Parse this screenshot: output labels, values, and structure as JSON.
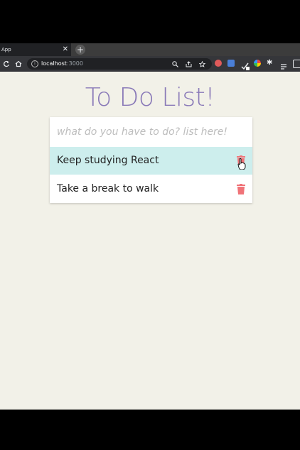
{
  "browser": {
    "tab_title": "App",
    "tab_close": "✕",
    "new_tab": "+",
    "url_host": "localhost",
    "url_port": ":3000",
    "info_glyph": "i"
  },
  "app": {
    "title": "To Do List!",
    "input_placeholder": "what do you have to do? list here!",
    "input_value": "",
    "items": [
      {
        "text": "Keep studying React",
        "highlighted": true
      },
      {
        "text": "Take a break to walk",
        "highlighted": false
      }
    ]
  },
  "colors": {
    "page_bg": "#f2f1e8",
    "title": "#8a7ab8",
    "highlight": "#cdeeed",
    "trash": "#f07378"
  },
  "icons": {
    "back": "reload-icon",
    "home": "home-icon",
    "trash": "trash-icon",
    "cursor": "hand-pointer-icon"
  }
}
